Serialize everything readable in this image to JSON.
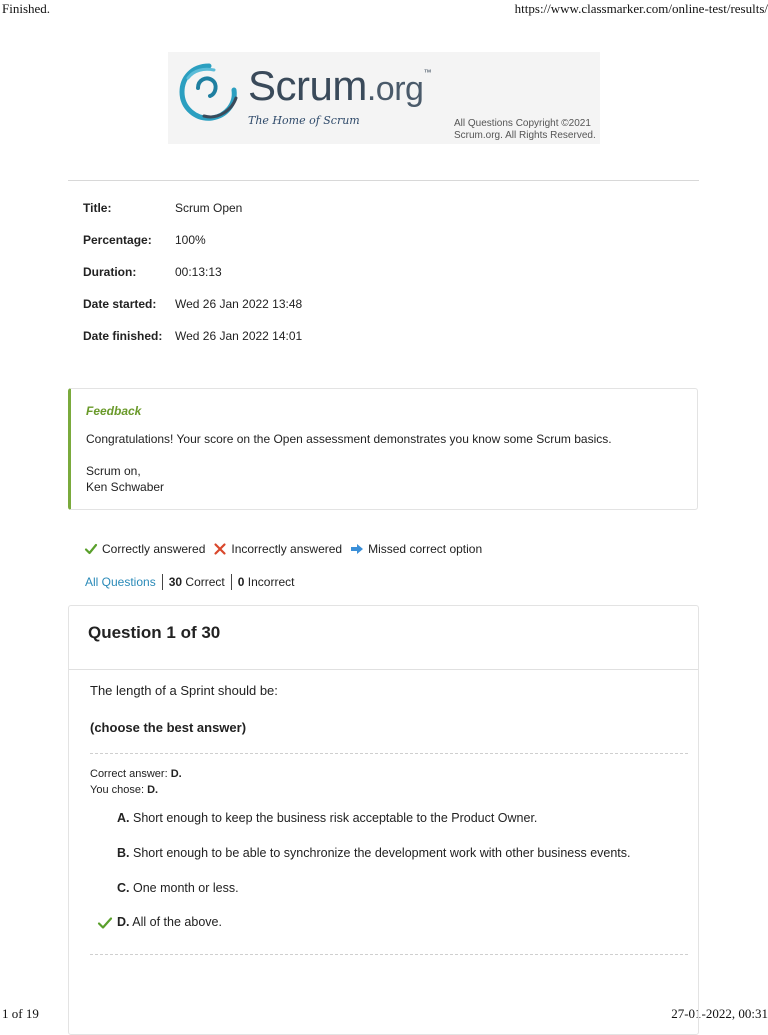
{
  "print": {
    "title": "Finished.",
    "url": "https://www.classmarker.com/online-test/results/",
    "page": "1 of 19",
    "datetime": "27-01-2022, 00:31"
  },
  "logo": {
    "word": "Scrum",
    "domain": ".org",
    "trademark": "™",
    "tagline": "The Home of Scrum",
    "copyright_line1": "All Questions Copyright ©2021",
    "copyright_line2": "Scrum.org. All Rights Reserved."
  },
  "details": {
    "title_label": "Title:",
    "title_value": "Scrum Open",
    "percentage_label": "Percentage:",
    "percentage_value": "100%",
    "duration_label": "Duration:",
    "duration_value": "00:13:13",
    "started_label": "Date started:",
    "started_value": "Wed 26 Jan 2022 13:48",
    "finished_label": "Date finished:",
    "finished_value": "Wed 26 Jan 2022 14:01"
  },
  "feedback": {
    "title": "Feedback",
    "body": "Congratulations! Your score on the Open assessment demonstrates you know some Scrum basics.",
    "signoff": "Scrum on,",
    "author": "Ken Schwaber"
  },
  "legend": {
    "correct": "Correctly answered",
    "incorrect": "Incorrectly answered",
    "missed": "Missed correct option",
    "correct_icon": "check-icon",
    "incorrect_icon": "cross-icon",
    "missed_icon": "arrow-right-icon"
  },
  "filters": {
    "all": "All Questions",
    "correct_count": "30",
    "correct_label": "Correct",
    "incorrect_count": "0",
    "incorrect_label": "Incorrect"
  },
  "question": {
    "heading": "Question 1 of 30",
    "prompt": "The length of a Sprint should be:",
    "instruction": "(choose the best answer)",
    "correct_label": "Correct answer:",
    "correct_value": "D.",
    "chose_label": "You chose:",
    "chose_value": "D.",
    "options": [
      {
        "letter": "A.",
        "text": "Short enough to keep the business risk acceptable to the Product Owner."
      },
      {
        "letter": "B.",
        "text": "Short enough to be able to synchronize the development work with other business events."
      },
      {
        "letter": "C.",
        "text": "One month or less."
      },
      {
        "letter": "D.",
        "text": "All of the above."
      }
    ]
  },
  "colors": {
    "correct": "#5aa02c",
    "incorrect": "#d9472b",
    "missed": "#3a8fd8",
    "link": "#2a8ab8",
    "feedback_accent": "#7aaa3c"
  }
}
